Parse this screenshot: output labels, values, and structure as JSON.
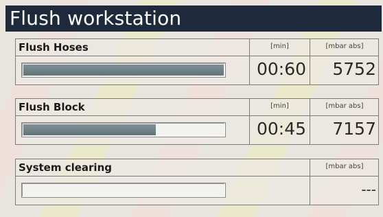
{
  "title": "Flush workstation",
  "sections": [
    {
      "name": "Flush Hoses",
      "unit_time": "[min]",
      "unit_pressure": "[mbar abs]",
      "progress": 1.0,
      "time": "00:60",
      "pressure": "5752"
    },
    {
      "name": "Flush Block",
      "unit_time": "[min]",
      "unit_pressure": "[mbar abs]",
      "progress": 0.66,
      "time": "00:45",
      "pressure": "7157"
    },
    {
      "name": "System clearing",
      "unit_pressure": "[mbar abs]",
      "progress": 0.0,
      "pressure": "---"
    }
  ],
  "colors": {
    "title_bg": "#1e2a3c",
    "bar_fill": "#6e8085"
  }
}
